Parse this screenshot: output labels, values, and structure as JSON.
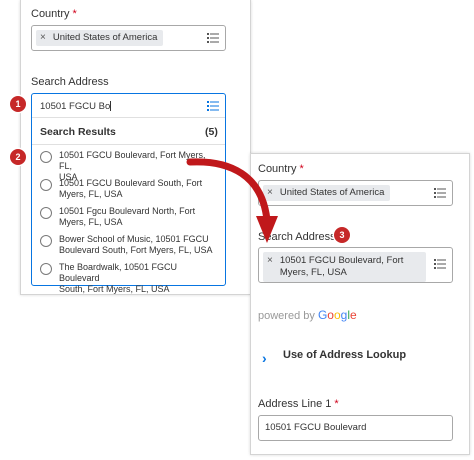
{
  "left_panel": {
    "country_label": "Country",
    "required_mark": "*",
    "country_chip": "United States of America",
    "chip_remove_glyph": "×",
    "search_label": "Search Address",
    "search_value": "10501 FGCU Bo",
    "results_title": "Search Results",
    "results_count": "(5)",
    "results": [
      {
        "line1": "10501 FGCU Boulevard, Fort Myers, FL,",
        "line2": "USA"
      },
      {
        "line1": "10501 FGCU Boulevard South, Fort",
        "line2": "Myers, FL, USA"
      },
      {
        "line1": "10501 Fgcu Boulevard North, Fort",
        "line2": "Myers, FL, USA"
      },
      {
        "line1": "Bower School of Music, 10501 FGCU",
        "line2": "Boulevard South, Fort Myers, FL, USA"
      },
      {
        "line1": "The Boardwalk, 10501 FGCU Boulevard",
        "line2": "South, Fort Myers, FL, USA"
      }
    ]
  },
  "right_panel": {
    "country_label": "Country",
    "required_mark": "*",
    "country_chip": "United States of America",
    "chip_remove_glyph": "×",
    "search_label": "Search Address",
    "address_chip_line1": "10501 FGCU Boulevard, Fort",
    "address_chip_line2": "Myers, FL, USA",
    "powered_by": "powered by",
    "google_letters": [
      "G",
      "o",
      "o",
      "g",
      "l",
      "e"
    ],
    "lookup_section": "Use of Address Lookup",
    "lookup_chevron": "›",
    "address_line1_label": "Address Line 1",
    "address_line1_value": "10501 FGCU Boulevard"
  },
  "badges": [
    "1",
    "2",
    "3"
  ],
  "colors": {
    "badge": "#c62828",
    "arrow": "#c0181b",
    "focus_border": "#0875e1",
    "chip_bg": "#e8eaed",
    "required": "#d0021b"
  },
  "icons": {
    "list": "list-icon",
    "remove": "close-icon",
    "chevron": "chevron-right-icon",
    "arrow": "curved-arrow-icon"
  }
}
